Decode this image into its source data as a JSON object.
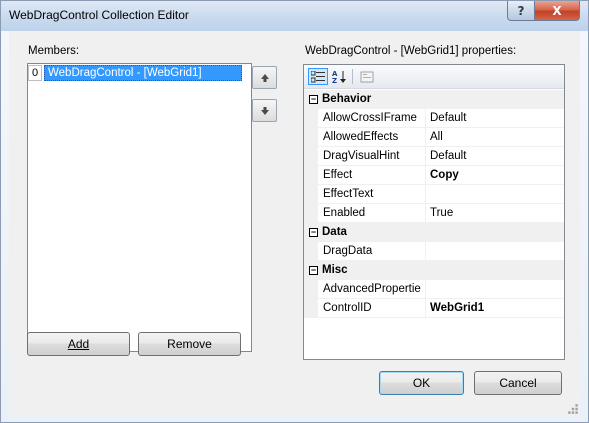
{
  "window": {
    "title": "WebDragControl Collection Editor"
  },
  "title_buttons": {
    "help": "?",
    "close": "X"
  },
  "members": {
    "label": "Members:",
    "items": [
      {
        "index": "0",
        "text": "WebDragControl - [WebGrid1]"
      }
    ]
  },
  "move_buttons": {
    "up_icon": "arrow-up-icon",
    "down_icon": "arrow-down-icon"
  },
  "actions": {
    "add_label": "Add",
    "remove_label": "Remove"
  },
  "properties": {
    "label": "WebDragControl - [WebGrid1] properties:",
    "toolbar": {
      "categorized_icon": "categorized-icon",
      "alphabetical_icon": "sort-az-icon",
      "pages_icon": "property-pages-icon"
    },
    "categories": [
      {
        "name": "Behavior",
        "props": [
          {
            "name": "AllowCrossIFrame",
            "value": "Default",
            "bold": false
          },
          {
            "name": "AllowedEffects",
            "value": "All",
            "bold": false
          },
          {
            "name": "DragVisualHint",
            "value": "Default",
            "bold": false
          },
          {
            "name": "Effect",
            "value": "Copy",
            "bold": true
          },
          {
            "name": "EffectText",
            "value": "",
            "bold": false
          },
          {
            "name": "Enabled",
            "value": "True",
            "bold": false
          }
        ]
      },
      {
        "name": "Data",
        "props": [
          {
            "name": "DragData",
            "value": "",
            "bold": false
          }
        ]
      },
      {
        "name": "Misc",
        "props": [
          {
            "name": "AdvancedPropertie",
            "value": "",
            "bold": false
          },
          {
            "name": "ControlID",
            "value": "WebGrid1",
            "bold": true
          }
        ]
      }
    ]
  },
  "dialog_buttons": {
    "ok_label": "OK",
    "cancel_label": "Cancel"
  },
  "colors": {
    "selection": "#3399ff",
    "close_button": "#c24226"
  }
}
